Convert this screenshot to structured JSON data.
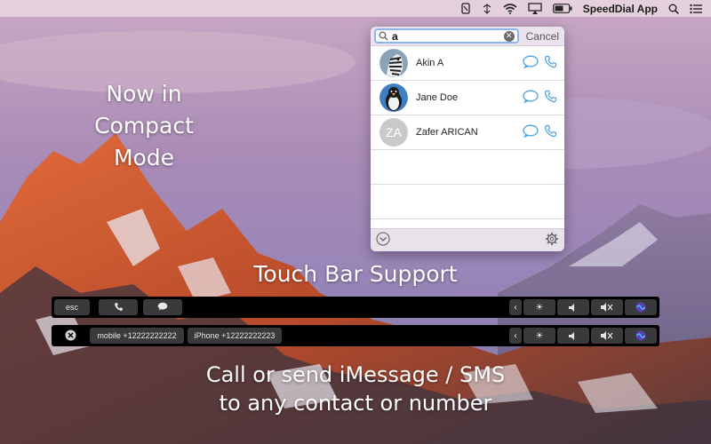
{
  "menubar": {
    "app_name": "SpeedDial App",
    "icons": [
      "speeddial-icon",
      "airdrop-icon",
      "wifi-icon",
      "airplay-icon",
      "battery-icon",
      "spotlight-icon",
      "notification-center-icon"
    ]
  },
  "popover": {
    "search": {
      "value": "a",
      "placeholder": ""
    },
    "cancel_label": "Cancel",
    "contacts": [
      {
        "name": "Akin A",
        "avatar": "zebra"
      },
      {
        "name": "Jane Doe",
        "avatar": "penguin"
      },
      {
        "name": "Zafer ARICAN",
        "avatar": "initials",
        "initials": "ZA"
      }
    ],
    "empty_rows": 2
  },
  "headlines": {
    "compact_line1": "Now in",
    "compact_line2": "Compact",
    "compact_line3": "Mode",
    "touchbar_title": "Touch Bar Support",
    "bottom_line1": "Call or send iMessage / SMS",
    "bottom_line2": "to any contact or number"
  },
  "touchbar1": {
    "esc_label": "esc",
    "keys": [
      "phone-icon",
      "message-icon"
    ]
  },
  "touchbar2": {
    "mobile_label": "mobile +12222222222",
    "iphone_label": "iPhone +12222222223"
  },
  "colors": {
    "accent_blue": "#4aa3df",
    "touchbar_key": "#3a3a3c",
    "search_ring": "#8fb6ea"
  }
}
